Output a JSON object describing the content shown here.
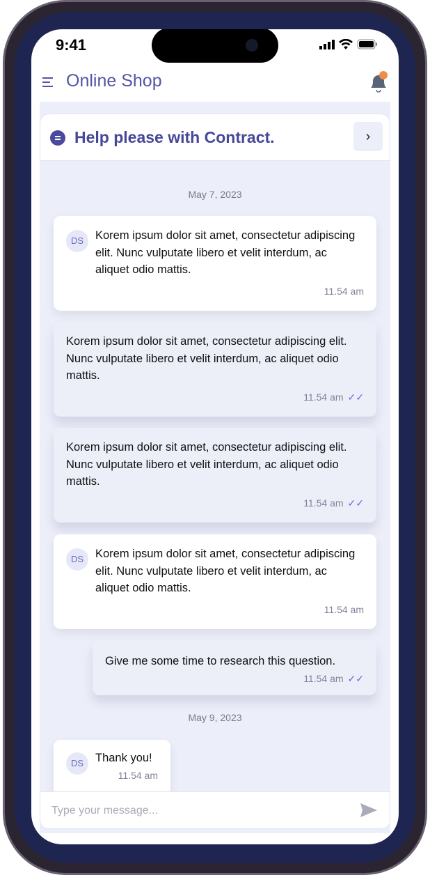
{
  "status_bar": {
    "time": "9:41"
  },
  "header": {
    "title": "Online Shop",
    "menu_icon": "menu-icon",
    "notification_icon": "bell-icon",
    "badge_color": "#f28c4c"
  },
  "chat": {
    "title": "Help please with Contract.",
    "dates": [
      "May 7, 2023",
      "May 9, 2023"
    ],
    "messages": [
      {
        "type": "incoming",
        "avatar": "DS",
        "text": "Korem ipsum dolor sit amet, consectetur adipiscing elit. Nunc vulputate libero et velit interdum, ac aliquet odio mattis.",
        "time": "11.54 am"
      },
      {
        "type": "outgoing",
        "text": "Korem ipsum dolor sit amet, consectetur adipiscing elit. Nunc vulputate libero et velit interdum, ac aliquet odio mattis.",
        "time": "11.54 am",
        "read": true
      },
      {
        "type": "outgoing",
        "text": "Korem ipsum dolor sit amet, consectetur adipiscing elit. Nunc vulputate libero et velit interdum, ac aliquet odio mattis.",
        "time": "11.54 am",
        "read": true
      },
      {
        "type": "incoming",
        "avatar": "DS",
        "text": "Korem ipsum dolor sit amet, consectetur adipiscing elit. Nunc vulputate libero et velit interdum, ac aliquet odio mattis.",
        "time": "11.54 am"
      },
      {
        "type": "outgoing",
        "text": "Give me some time to research this question.",
        "time": "11.54 am",
        "read": true
      },
      {
        "type": "incoming",
        "avatar": "DS",
        "text": "Thank you!",
        "time": "11.54 am"
      }
    ]
  },
  "composer": {
    "placeholder": "Type your message...",
    "value": ""
  },
  "colors": {
    "accent": "#4a4aa0",
    "background": "#eceef9"
  }
}
